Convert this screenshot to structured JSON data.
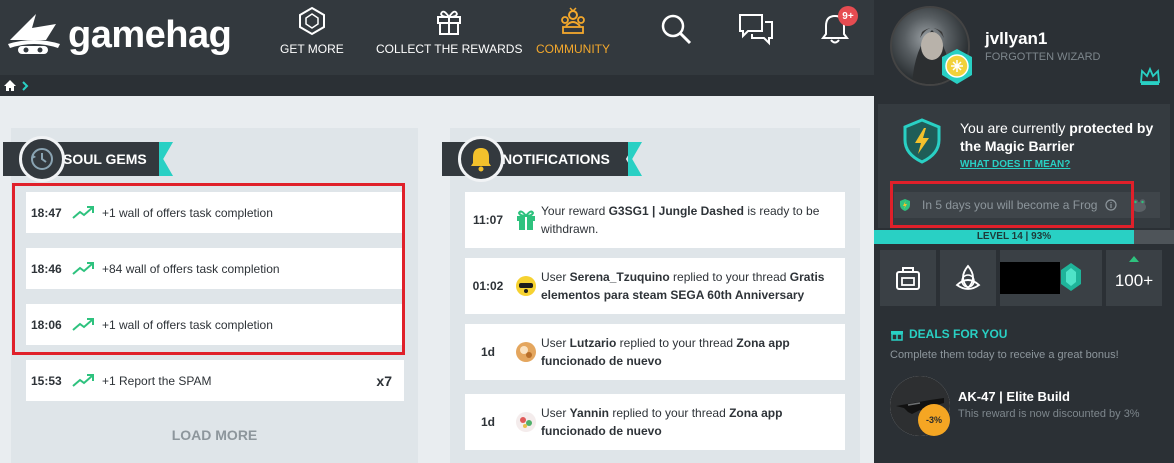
{
  "brand": {
    "name": "gamehag"
  },
  "nav": {
    "items": [
      {
        "label": "GET MORE",
        "icon": "gem-icon"
      },
      {
        "label": "COLLECT THE REWARDS",
        "icon": "gift-icon"
      },
      {
        "label": "COMMUNITY",
        "icon": "community-icon",
        "active": true
      }
    ],
    "search_icon": "search-icon",
    "chat_icon": "chat-icon",
    "bell_icon": "bell-icon",
    "bell_badge": "9+"
  },
  "breadcrumb": {
    "home_icon": "home-icon",
    "chevron_icon": "chevron-right-icon"
  },
  "soul_gems": {
    "title": "SOUL GEMS",
    "rows": [
      {
        "time": "18:47",
        "text": "+1 wall of offers task completion",
        "mult": ""
      },
      {
        "time": "18:46",
        "text": "+84 wall of offers task completion",
        "mult": ""
      },
      {
        "time": "18:06",
        "text": "+1 wall of offers task completion",
        "mult": ""
      },
      {
        "time": "15:53",
        "text": "+1 Report the SPAM",
        "mult": "x7"
      }
    ],
    "load_more": "LOAD MORE"
  },
  "notifications": {
    "title": "NOTIFICATIONS",
    "items": [
      {
        "time": "11:07",
        "pre": "Your reward ",
        "bold1": "G3SG1 | Jungle Dashed",
        "mid": " is ready to be withdrawn.",
        "bold2": "",
        "post": ""
      },
      {
        "time": "01:02",
        "pre": "User ",
        "bold1": "Serena_Tzuquino",
        "mid": " replied to your thread ",
        "bold2": "Gratis elementos para steam SEGA 60th Anniversary",
        "post": ""
      },
      {
        "time": "1d",
        "pre": "User ",
        "bold1": "Lutzario",
        "mid": " replied to your thread ",
        "bold2": "Zona app funcionado de nuevo",
        "post": ""
      },
      {
        "time": "1d",
        "pre": "User ",
        "bold1": "Yannin",
        "mid": " replied to your thread ",
        "bold2": "Zona app funcionado de nuevo",
        "post": ""
      }
    ]
  },
  "profile": {
    "username": "jvllyan1",
    "title": "FORGOTTEN WIZARD"
  },
  "magic_barrier": {
    "line_pre": "You are currently ",
    "line_bold": "protected by the Magic Barrier",
    "link": "WHAT DOES IT MEAN?",
    "frog_text": "In 5 days you will become a Frog"
  },
  "level": {
    "label": "LEVEL 14 | 93%",
    "percent": 93
  },
  "tiles": {
    "more_label": "100+"
  },
  "deals": {
    "title": "DEALS FOR YOU",
    "subtitle": "Complete them today to receive a great bonus!",
    "item_name": "AK-47 | Elite Build",
    "item_desc": "This reward is now discounted by 3%",
    "discount": "-3%"
  },
  "colors": {
    "accent": "#29d0c4",
    "active_nav": "#f3a82c",
    "highlight": "#e0202a",
    "dark": "#33393e"
  }
}
